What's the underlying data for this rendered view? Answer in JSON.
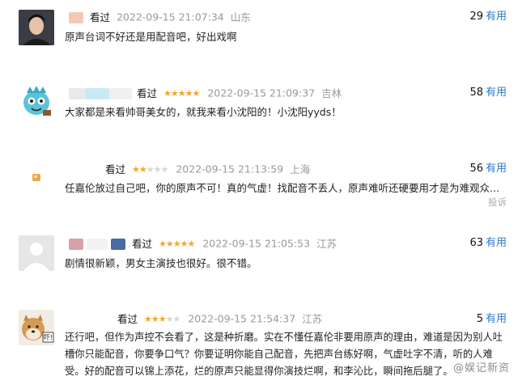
{
  "reviews": [
    {
      "rated_label": "看过",
      "stars": 0,
      "time": "2022-09-15 21:07:34",
      "location": "山东",
      "votes": "29",
      "useful_label": "有用",
      "content": "原声台词不好还是用配音吧，好出戏啊",
      "avatar_icon": "man-portrait-avatar",
      "name_colors": [
        "#f3c9b6"
      ]
    },
    {
      "rated_label": "看过",
      "stars": 5,
      "time": "2022-09-15 21:09:37",
      "location": "吉林",
      "votes": "58",
      "useful_label": "有用",
      "content": "大家都是来看帅哥美女的，就我来看小沈阳的！小沈阳yyds！",
      "avatar_icon": "cartoon-avatar",
      "name_colors": [
        "#c9eaf5",
        "#e9e9e9"
      ]
    },
    {
      "rated_label": "看过",
      "stars": 2,
      "time": "2022-09-15 21:13:59",
      "location": "上海",
      "votes": "56",
      "useful_label": "有用",
      "content": "任嘉伦放过自己吧，你的原声不可！真的气虚！找配音不丢人，原声难听还硬要用才是为难观众...",
      "report_label": "投诉",
      "avatar_icon": "small-orange-avatar",
      "name_colors": []
    },
    {
      "rated_label": "看过",
      "stars": 5,
      "time": "2022-09-15 21:05:53",
      "location": "江苏",
      "votes": "63",
      "useful_label": "有用",
      "content": "剧情很新颖，男女主演技也很好。很不错。",
      "avatar_icon": "default-user-avatar",
      "name_colors": [
        "#d9a0a8",
        "#4a6aa8"
      ]
    },
    {
      "rated_label": "看过",
      "stars": 3,
      "time": "2022-09-15 21:54:37",
      "location": "江苏",
      "votes": "5",
      "useful_label": "有用",
      "content": "还行吧，但作为声控不会看了，这是种折磨。实在不懂任嘉伦非要用原声的理由，难道是因为别人吐槽你只能配音，你要争口气？你要证明你能自己配音，先把声台练好啊，气虚吐字不清，听的人难受。好的配音可以锦上添花，烂的原声只能显得你演技烂啊，和李沁比，瞬间拖后腿了。",
      "avatar_icon": "shiba-dog-avatar",
      "name_colors": []
    }
  ],
  "watermark": "@娱记新资",
  "colors": {
    "star_on": "#f5a623",
    "star_off": "#d6d6d6",
    "link_blue": "#2b7ac9"
  }
}
